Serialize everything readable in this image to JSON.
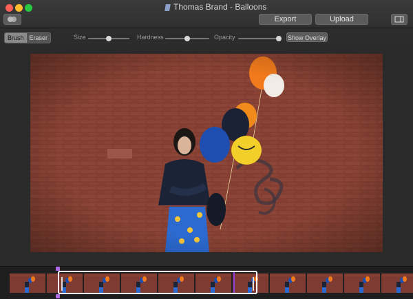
{
  "window": {
    "title": "Thomas Brand - Balloons"
  },
  "toolbar": {
    "export_label": "Export",
    "upload_label": "Upload",
    "tools": [
      "Brush",
      "Eraser"
    ],
    "selected_tool": "Brush",
    "sliders": [
      {
        "label": "Size",
        "value": 0.5
      },
      {
        "label": "Hardness",
        "value": 0.5
      },
      {
        "label": "Opacity",
        "value": 0.95
      }
    ],
    "overlay_label": "Show Overlay"
  },
  "photo": {
    "description": "woman with balloons in front of brick wall"
  },
  "filmstrip": {
    "frame_count": 11,
    "selection": {
      "start": 0.14,
      "end": 0.63
    },
    "playhead": 0.57
  },
  "colors": {
    "accent": "#8a3cdc"
  }
}
